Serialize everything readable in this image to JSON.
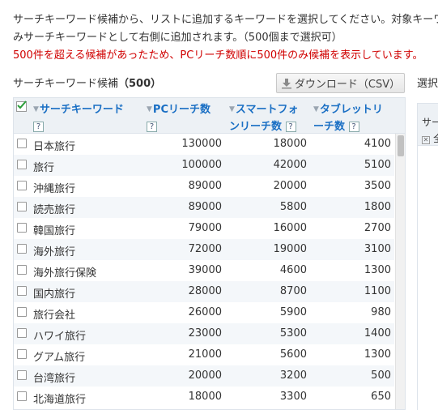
{
  "intro": {
    "line1": "サーチキーワード候補から、リストに追加するキーワードを選択してください。対象キーワ",
    "line2": "みサーチキーワードとして右側に追加されます。（500個まで選択可）",
    "warning": "500件を超える候補があったため、PCリーチ数順に500件のみ候補を表示しています。"
  },
  "section": {
    "title": "サーチキーワード候補",
    "count": "（500）"
  },
  "download_button": "ダウンロード（CSV）",
  "right": {
    "label": "選択",
    "header": "サー",
    "remove_all": "全"
  },
  "table": {
    "headers": {
      "keyword": "サーチキーワード",
      "pc": "PCリーチ数",
      "smartphone_line1": "スマートフォ",
      "smartphone_line2": "ンリーチ数",
      "tablet_line1": "タブレットリ",
      "tablet_line2": "ーチ数",
      "help": "?"
    },
    "rows": [
      {
        "keyword": "日本旅行",
        "pc": "130000",
        "sp": "18000",
        "tb": "4100"
      },
      {
        "keyword": "旅行",
        "pc": "100000",
        "sp": "42000",
        "tb": "5100"
      },
      {
        "keyword": "沖縄旅行",
        "pc": "89000",
        "sp": "20000",
        "tb": "3500"
      },
      {
        "keyword": "読売旅行",
        "pc": "89000",
        "sp": "5800",
        "tb": "1800"
      },
      {
        "keyword": "韓国旅行",
        "pc": "79000",
        "sp": "16000",
        "tb": "2700"
      },
      {
        "keyword": "海外旅行",
        "pc": "72000",
        "sp": "19000",
        "tb": "3100"
      },
      {
        "keyword": "海外旅行保険",
        "pc": "39000",
        "sp": "4600",
        "tb": "1300"
      },
      {
        "keyword": "国内旅行",
        "pc": "28000",
        "sp": "8700",
        "tb": "1100"
      },
      {
        "keyword": "旅行会社",
        "pc": "26000",
        "sp": "5900",
        "tb": "980"
      },
      {
        "keyword": "ハワイ旅行",
        "pc": "23000",
        "sp": "5300",
        "tb": "1400"
      },
      {
        "keyword": "グアム旅行",
        "pc": "21000",
        "sp": "5600",
        "tb": "1300"
      },
      {
        "keyword": "台湾旅行",
        "pc": "20000",
        "sp": "3200",
        "tb": "500"
      },
      {
        "keyword": "北海道旅行",
        "pc": "18000",
        "sp": "3300",
        "tb": "650"
      }
    ]
  }
}
